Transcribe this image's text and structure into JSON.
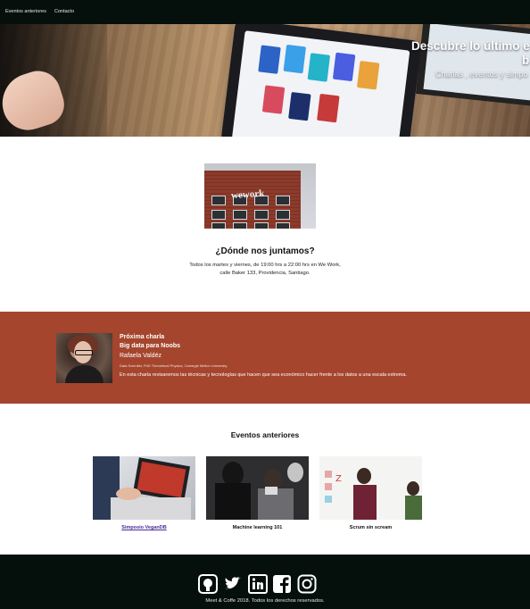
{
  "nav": {
    "items": [
      {
        "label": "Eventos anteriores"
      },
      {
        "label": "Contacto"
      }
    ]
  },
  "hero": {
    "title_line1": "Descubre lo último e",
    "title_line2": "b",
    "subtitle": "Charlas , eventos y simpo"
  },
  "where": {
    "image_text": "wework",
    "title": "¿Dónde nos juntamos?",
    "text_line1": "Todos los martes y viernes, de 19:00 hrs a 22:00 hrs en We Work,",
    "text_line2": "calle Baker 133, Providencia, Santiago."
  },
  "next_talk": {
    "heading": "Próxima charla",
    "title": "Big data para Noobs",
    "speaker": "Rafaela Valdéz",
    "speaker_bio": "Data Scientist, PhD Theoretical Physics, Carnegie Mellon University.",
    "description": "En esta charla revisaremos las técnicas y tecnologías que hacen que sea económico hacer frente a los datos a una escala extrema."
  },
  "past_events": {
    "title": "Eventos anteriores",
    "items": [
      {
        "caption": "Simposio VeganDB"
      },
      {
        "caption": "Machine learning 101"
      },
      {
        "caption": "Scrum sin scream"
      }
    ]
  },
  "footer": {
    "social": [
      "github-icon",
      "twitter-icon",
      "linkedin-icon",
      "facebook-icon",
      "instagram-icon"
    ],
    "text": "Meet & Coffe 2018. Todos los derechos reservados."
  },
  "colors": {
    "nav_bg": "#050f0c",
    "talk_bg": "#a5452d",
    "link": "#4a2a9a"
  }
}
